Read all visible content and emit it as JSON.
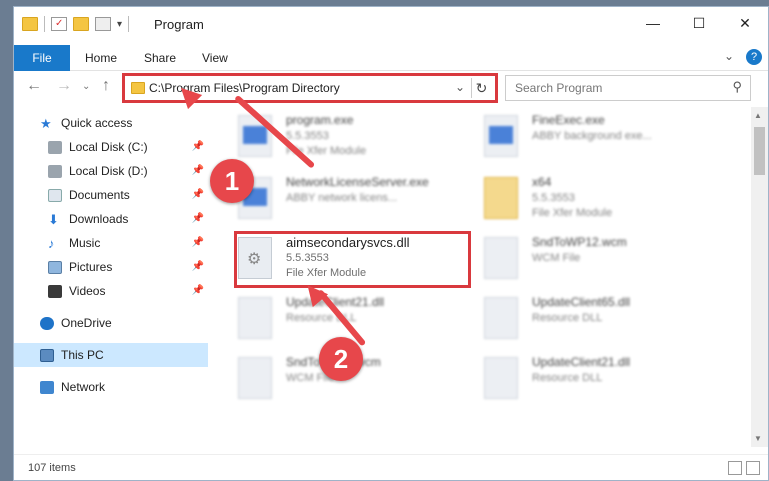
{
  "title": "Program",
  "ribbon": {
    "file": "File",
    "tabs": [
      "Home",
      "Share",
      "View"
    ]
  },
  "address": {
    "path": "C:\\Program Files\\Program Directory"
  },
  "search": {
    "placeholder": "Search Program"
  },
  "sidebar": {
    "items": [
      {
        "label": "Quick access"
      },
      {
        "label": "Local Disk (C:)"
      },
      {
        "label": "Local Disk (D:)"
      },
      {
        "label": "Documents"
      },
      {
        "label": "Downloads"
      },
      {
        "label": "Music"
      },
      {
        "label": "Pictures"
      },
      {
        "label": "Videos"
      },
      {
        "label": "OneDrive"
      },
      {
        "label": "This PC"
      },
      {
        "label": "Network"
      }
    ]
  },
  "files": [
    {
      "name": "program.exe",
      "meta1": "5.5.3553",
      "meta2": "File Xfer Module"
    },
    {
      "name": "FineExec.exe",
      "meta1": "ABBY background exe...",
      "meta2": ""
    },
    {
      "name": "NetworkLicenseServer.exe",
      "meta1": "ABBY network licens...",
      "meta2": ""
    },
    {
      "name": "x64",
      "meta1": "5.5.3553",
      "meta2": "File Xfer Module"
    },
    {
      "name": "aimsecondarysvcs.dll",
      "meta1": "5.5.3553",
      "meta2": "File Xfer Module"
    },
    {
      "name": "SndToWP12.wcm",
      "meta1": "WCM File",
      "meta2": ""
    },
    {
      "name": "UpdateClient21.dll",
      "meta1": "Resource DLL",
      "meta2": ""
    },
    {
      "name": "UpdateClient65.dll",
      "meta1": "Resource DLL",
      "meta2": ""
    },
    {
      "name": "SndToWP12.wcm",
      "meta1": "WCM File",
      "meta2": ""
    },
    {
      "name": "UpdateClient21.dll",
      "meta1": "Resource DLL",
      "meta2": ""
    }
  ],
  "status": {
    "count": "107 items"
  },
  "callouts": {
    "one": "1",
    "two": "2"
  },
  "colors": {
    "accent": "#1979ca",
    "highlight": "#d9393e",
    "callout": "#e7474b"
  }
}
